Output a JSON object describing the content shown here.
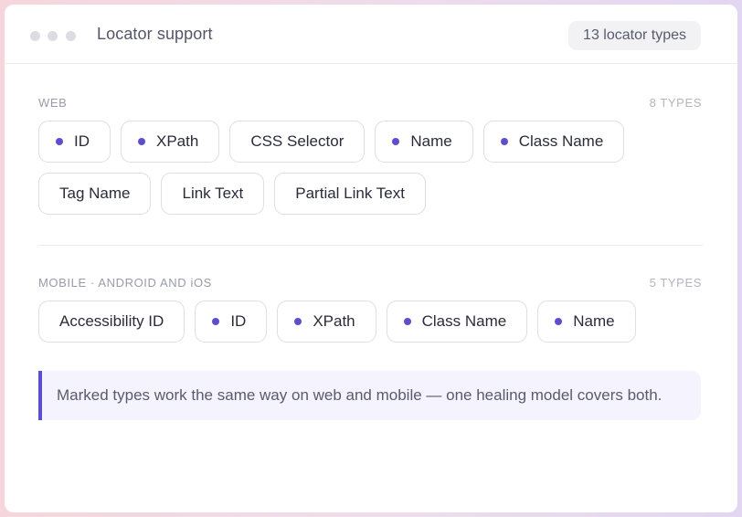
{
  "window": {
    "title": "Locator support",
    "badge": "13 locator types"
  },
  "sections": {
    "web": {
      "label": "WEB",
      "count": "8 TYPES",
      "rows": [
        [
          {
            "label": "ID",
            "marked": true
          },
          {
            "label": "XPath",
            "marked": true
          },
          {
            "label": "CSS Selector",
            "marked": false
          },
          {
            "label": "Name",
            "marked": true
          },
          {
            "label": "Class Name",
            "marked": true
          }
        ],
        [
          {
            "label": "Tag Name",
            "marked": false
          },
          {
            "label": "Link Text",
            "marked": false
          },
          {
            "label": "Partial Link Text",
            "marked": false
          }
        ]
      ]
    },
    "mobile": {
      "label": "MOBILE · ANDROID AND iOS",
      "count": "5 TYPES",
      "rows": [
        [
          {
            "label": "Accessibility ID",
            "marked": false
          },
          {
            "label": "ID",
            "marked": true
          },
          {
            "label": "XPath",
            "marked": true
          },
          {
            "label": "Class Name",
            "marked": true
          },
          {
            "label": "Name",
            "marked": true
          }
        ]
      ]
    }
  },
  "note": {
    "text": "Marked types work the same way on web and mobile — one healing model covers both."
  },
  "colors": {
    "accent": "#5b4fcf",
    "note_background": "#f5f3fe"
  }
}
